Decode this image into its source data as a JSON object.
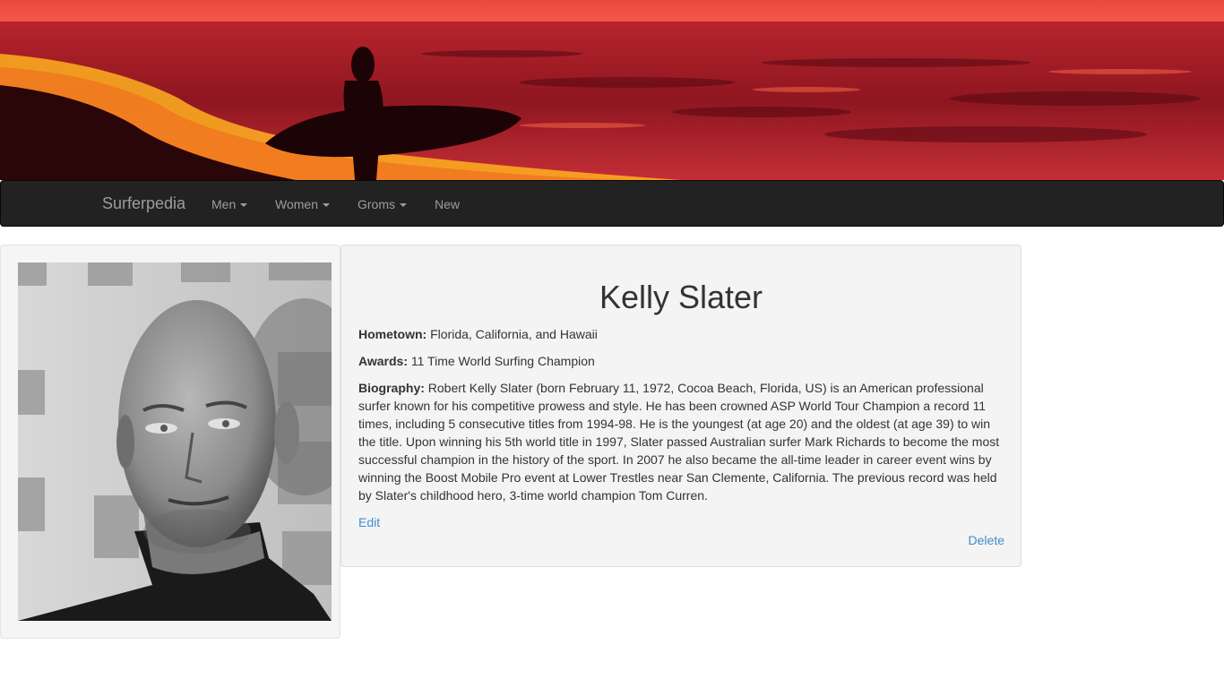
{
  "nav": {
    "brand": "Surferpedia",
    "items": [
      {
        "label": "Men",
        "dropdown": true
      },
      {
        "label": "Women",
        "dropdown": true
      },
      {
        "label": "Groms",
        "dropdown": true
      },
      {
        "label": "New",
        "dropdown": false
      }
    ]
  },
  "surfer": {
    "name": "Kelly Slater",
    "hometown_label": "Hometown:",
    "hometown": "Florida, California, and Hawaii",
    "awards_label": "Awards:",
    "awards": "11 Time World Surfing Champion",
    "biography_label": "Biography:",
    "biography": "Robert Kelly Slater (born February 11, 1972, Cocoa Beach, Florida, US) is an American professional surfer known for his competitive prowess and style. He has been crowned ASP World Tour Champion a record 11 times, including 5 consecutive titles from 1994-98. He is the youngest (at age 20) and the oldest (at age 39) to win the title. Upon winning his 5th world title in 1997, Slater passed Australian surfer Mark Richards to become the most successful champion in the history of the sport. In 2007 he also became the all-time leader in career event wins by winning the Boost Mobile Pro event at Lower Trestles near San Clemente, California. The previous record was held by Slater's childhood hero, 3-time world champion Tom Curren."
  },
  "actions": {
    "edit": "Edit",
    "delete": "Delete"
  },
  "colors": {
    "navbar_bg": "#222222",
    "nav_text": "#9d9d9d",
    "link": "#428bca",
    "well_bg": "#f4f4f4"
  }
}
